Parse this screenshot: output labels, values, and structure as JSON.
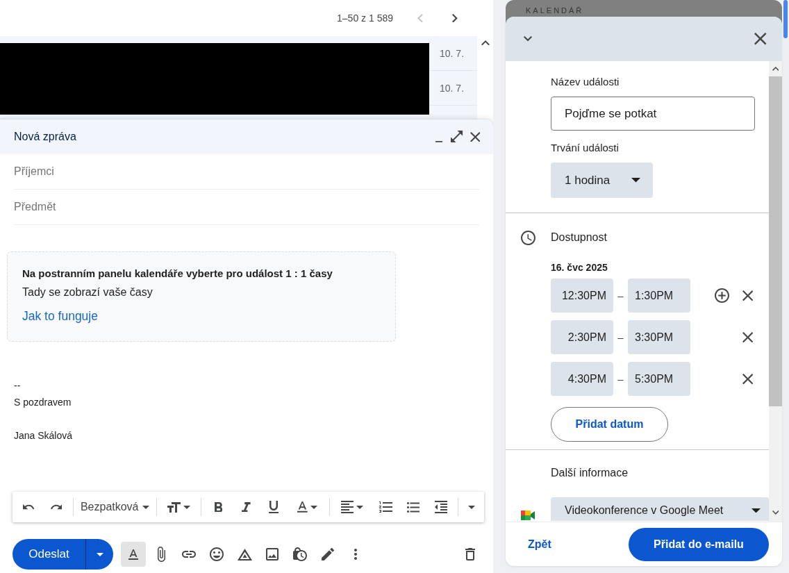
{
  "inbox": {
    "pagination": "1–50 z 1 589",
    "prev_disabled": true,
    "next_disabled": false,
    "rows": [
      {
        "date": "10. 7."
      },
      {
        "date": "10. 7."
      }
    ]
  },
  "compose": {
    "title": "Nová zpráva",
    "fields": [
      {
        "placeholder": "Příjemci"
      },
      {
        "placeholder": "Předmět"
      }
    ],
    "info_card": {
      "title": "Na postranním panelu kalendáře vyberte pro událost 1 : 1 časy",
      "text": "Tady se zobrazí vaše časy",
      "link": "Jak to funguje"
    },
    "signature": [
      [
        "--",
        "S pozdravem"
      ],
      [
        "Jana Skálová"
      ]
    ],
    "format_toolbar": [
      [
        {
          "kind": "undo"
        },
        {
          "kind": "redo"
        }
      ],
      [
        {
          "kind": "font",
          "label": "Bezpatková"
        }
      ],
      [
        {
          "kind": "text_size"
        }
      ],
      [
        {
          "kind": "bold"
        },
        {
          "kind": "italic"
        },
        {
          "kind": "underline"
        },
        {
          "kind": "text_color"
        }
      ],
      [
        {
          "kind": "align"
        },
        {
          "kind": "numbered_list"
        },
        {
          "kind": "bulleted_list"
        },
        {
          "kind": "indent_less"
        }
      ],
      [
        {
          "kind": "more_options"
        }
      ]
    ],
    "send_label": "Odeslat",
    "tools": [
      {
        "kind": "formatting",
        "selected": true
      },
      {
        "kind": "attach",
        "selected": false
      },
      {
        "kind": "link",
        "selected": false
      },
      {
        "kind": "emoji",
        "selected": false
      },
      {
        "kind": "drive",
        "selected": false
      },
      {
        "kind": "photo",
        "selected": false
      },
      {
        "kind": "confidential",
        "selected": false
      },
      {
        "kind": "signature",
        "selected": false
      },
      {
        "kind": "more",
        "selected": false
      }
    ]
  },
  "calendar": {
    "header": "KALENDÁŘ",
    "event_name": {
      "label": "Název události",
      "value": "Pojďme se potkat"
    },
    "duration": {
      "label": "Trvání události",
      "value": "1 hodina"
    },
    "availability": {
      "heading": "Dostupnost",
      "date": "16. čvc 2025",
      "slots": [
        {
          "start": "12:30PM",
          "separator": "–",
          "end": "1:30PM",
          "add_button": true
        },
        {
          "start": "2:30PM",
          "separator": "–",
          "end": "3:30PM",
          "add_button": false
        },
        {
          "start": "4:30PM",
          "separator": "–",
          "end": "5:30PM",
          "add_button": false
        }
      ],
      "add_date": "Přidat datum"
    },
    "more_info": {
      "heading": "Další informace",
      "conference": "Videokonference v Google Meet"
    },
    "back": "Zpět",
    "submit": "Přidat do e-mailu"
  }
}
